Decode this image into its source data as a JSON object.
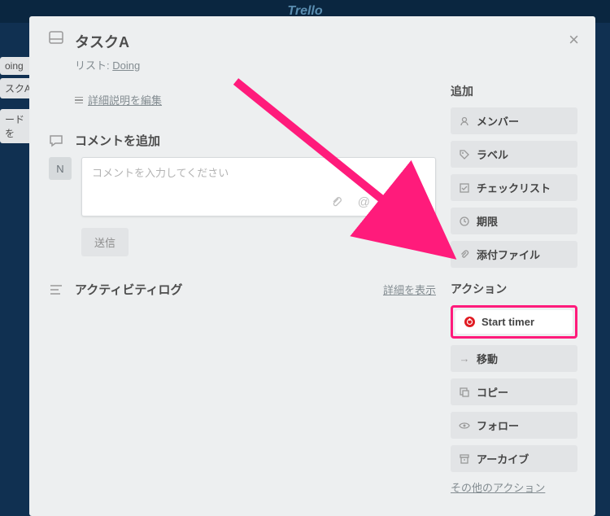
{
  "bg": {
    "logo": "Trello",
    "item1": "oing",
    "item2": "スクA",
    "item3": "ードを"
  },
  "card": {
    "title": "タスクA",
    "listLabel": "リスト:",
    "listName": "Doing",
    "descEdit": "詳細説明を編集"
  },
  "comment": {
    "title": "コメントを追加",
    "avatar": "N",
    "placeholder": "コメントを入力してください",
    "submit": "送信"
  },
  "activity": {
    "title": "アクティビティログ",
    "detailLink": "詳細を表示"
  },
  "side": {
    "addTitle": "追加",
    "add": [
      {
        "label": "メンバー"
      },
      {
        "label": "ラベル"
      },
      {
        "label": "チェックリスト"
      },
      {
        "label": "期限"
      },
      {
        "label": "添付ファイル"
      }
    ],
    "actionTitle": "アクション",
    "startTimer": "Start timer",
    "actions": [
      {
        "label": "移動"
      },
      {
        "label": "コピー"
      },
      {
        "label": "フォロー"
      },
      {
        "label": "アーカイブ"
      }
    ],
    "other": "その他のアクション"
  }
}
